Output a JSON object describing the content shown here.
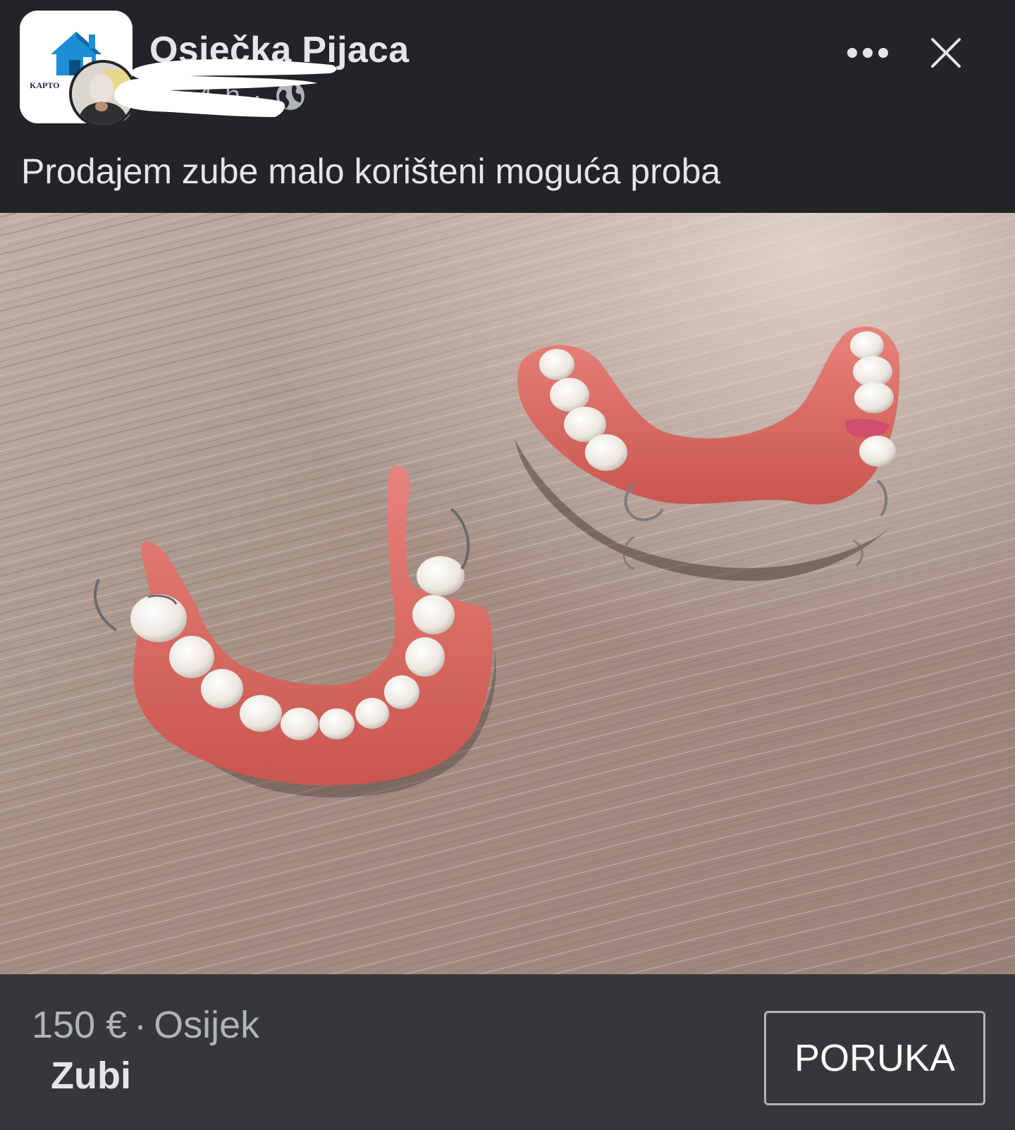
{
  "header": {
    "group_name": "Osječka Pijaca",
    "group_logo_text": "KAPTO",
    "author_name_partial": "o",
    "separator": "·",
    "time": "4 h",
    "privacy_icon": "globe-icon",
    "more_icon": "more-dots-icon",
    "close_icon": "close-icon"
  },
  "post": {
    "text": "Prodajem zube malo korišteni moguća proba"
  },
  "listing": {
    "price": "150 €",
    "separator": "·",
    "location": "Osijek",
    "title": "Zubi",
    "message_button_label": "PORUKA"
  },
  "colors": {
    "background": "#232427",
    "bottom_bar": "#36373a",
    "primary_text": "#e4e6eb",
    "secondary_text": "#b0b3b8"
  }
}
